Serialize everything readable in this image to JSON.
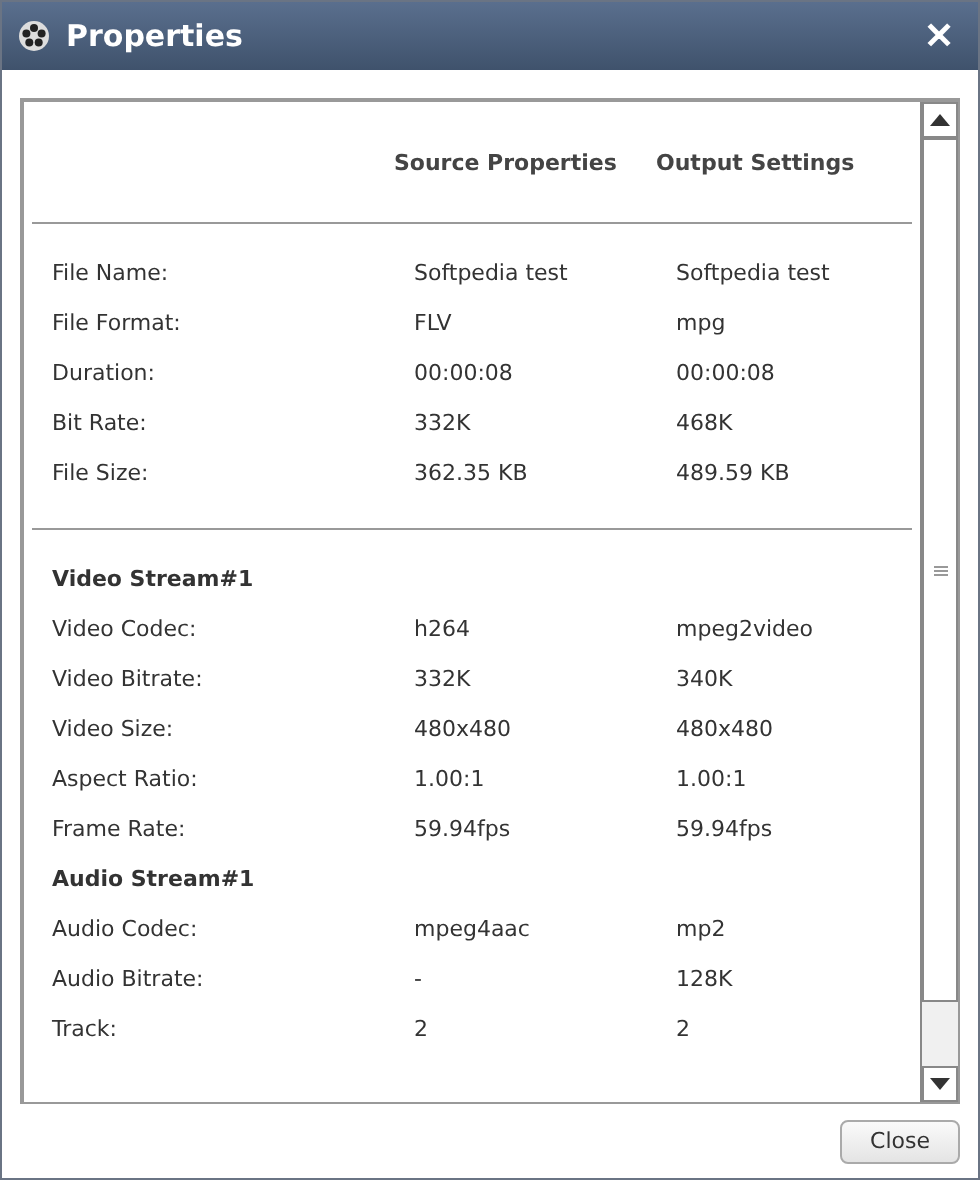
{
  "window": {
    "title": "Properties",
    "close_symbol": "✕"
  },
  "columns": [
    "Source Properties",
    "Output Settings"
  ],
  "sections": [
    {
      "rows": [
        {
          "label": "File Name:",
          "source": "Softpedia test",
          "output": "Softpedia test"
        },
        {
          "label": "File Format:",
          "source": "FLV",
          "output": "mpg"
        },
        {
          "label": "Duration:",
          "source": "00:00:08",
          "output": "00:00:08"
        },
        {
          "label": "Bit Rate:",
          "source": "332K",
          "output": "468K"
        },
        {
          "label": "File Size:",
          "source": "362.35 KB",
          "output": "489.59 KB"
        }
      ]
    },
    {
      "title": "Video Stream#1",
      "rows": [
        {
          "label": "Video Codec:",
          "source": "h264",
          "output": "mpeg2video"
        },
        {
          "label": "Video Bitrate:",
          "source": "332K",
          "output": "340K"
        },
        {
          "label": "Video Size:",
          "source": "480x480",
          "output": "480x480"
        },
        {
          "label": "Aspect Ratio:",
          "source": "1.00:1",
          "output": "1.00:1"
        },
        {
          "label": "Frame Rate:",
          "source": "59.94fps",
          "output": "59.94fps"
        }
      ]
    },
    {
      "title": "Audio Stream#1",
      "rows": [
        {
          "label": "Audio Codec:",
          "source": "mpeg4aac",
          "output": "mp2"
        },
        {
          "label": "Audio Bitrate:",
          "source": "-",
          "output": "128K"
        },
        {
          "label": "Track:",
          "source": "2",
          "output": "2"
        }
      ]
    }
  ],
  "close_button": "Close"
}
